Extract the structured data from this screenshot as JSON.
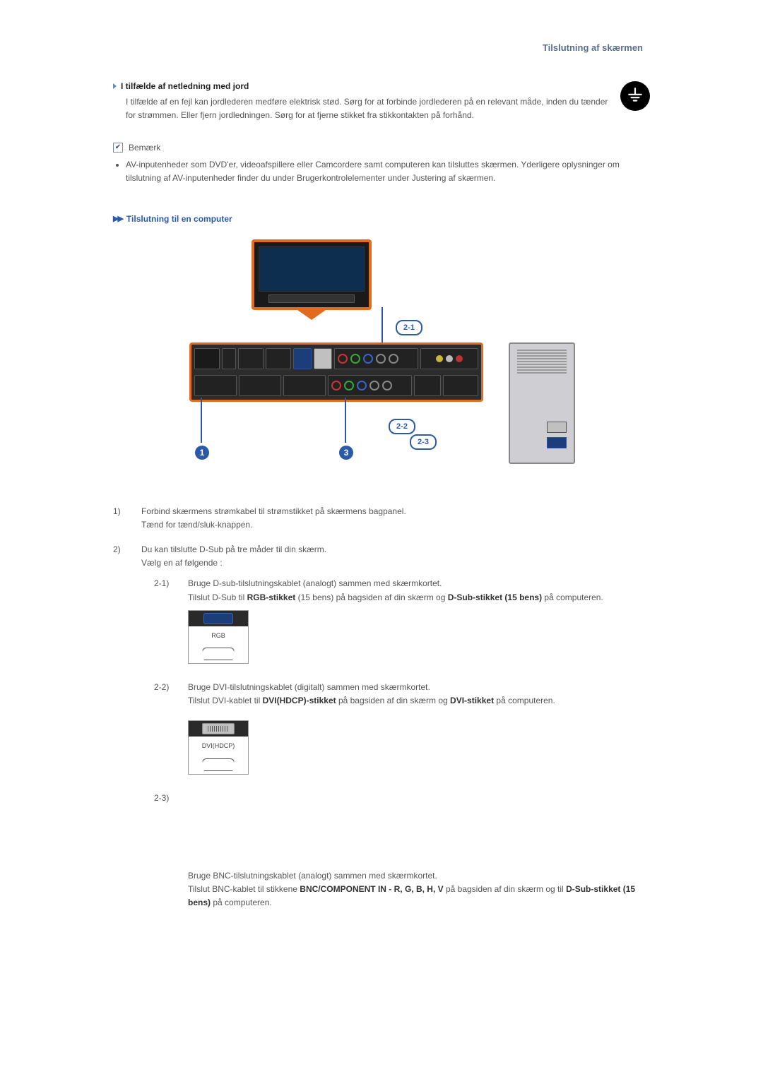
{
  "header": {
    "title": "Tilslutning af skærmen"
  },
  "section1": {
    "heading": "I tilfælde af netledning med jord",
    "body": "I tilfælde af en fejl kan jordlederen medføre elektrisk stød. Sørg for at forbinde jordlederen på en relevant måde, inden du tænder for strømmen. Eller fjern jordledningen. Sørg for at fjerne stikket fra stikkontakten på forhånd."
  },
  "note": {
    "label": "Bemærk",
    "item1": "AV-inputenheder som DVD'er, videoafspillere eller Camcordere samt computeren kan tilsluttes skærmen. Yderligere oplysninger om tilslutning af AV-inputenheder finder du under Brugerkontrolelementer under Justering af skærmen."
  },
  "section2": {
    "heading": "Tilslutning til en computer"
  },
  "callouts": {
    "c21": "2-1",
    "c22": "2-2",
    "c23": "2-3",
    "n1": "1",
    "n3": "3"
  },
  "steps": {
    "s1_num": "1)",
    "s1_a": "Forbind skærmens strømkabel til strømstikket på skærmens bagpanel.",
    "s1_b": "Tænd for tænd/sluk-knappen.",
    "s2_num": "2)",
    "s2_a": "Du kan tilslutte D-Sub på tre måder til din skærm.",
    "s2_b": "Vælg en af følgende :",
    "s21_num": "2-1)",
    "s21_a": "Bruge D-sub-tilslutningskablet (analogt) sammen med skærmkortet.",
    "s21_b_pre": "Tilslut D-Sub til ",
    "s21_b_b1": "RGB-stikket",
    "s21_b_mid": " (15 bens) på bagsiden af din skærm og ",
    "s21_b_b2": "D-Sub-stikket (15 bens)",
    "s21_b_post": " på computeren.",
    "s21_port_label": "RGB",
    "s22_num": "2-2)",
    "s22_a": "Bruge DVI-tilslutningskablet (digitalt) sammen med skærmkortet.",
    "s22_b_pre": "Tilslut DVI-kablet til ",
    "s22_b_b1": "DVI(HDCP)-stikket",
    "s22_b_mid": " på bagsiden af din skærm og ",
    "s22_b_b2": "DVI-stikket",
    "s22_b_post": " på computeren.",
    "s22_port_label": "DVI(HDCP)",
    "s23_num": "2-3)",
    "s23_a": "Bruge BNC-tilslutningskablet (analogt) sammen med skærmkortet.",
    "s23_b_pre": "Tilslut BNC-kablet til stikkene ",
    "s23_b_b1": "BNC/COMPONENT IN - R, G, B, H, V",
    "s23_b_mid": " på bagsiden af din skærm og til ",
    "s23_b_b2": "D-Sub-stikket (15 bens)",
    "s23_b_post": " på computeren."
  }
}
